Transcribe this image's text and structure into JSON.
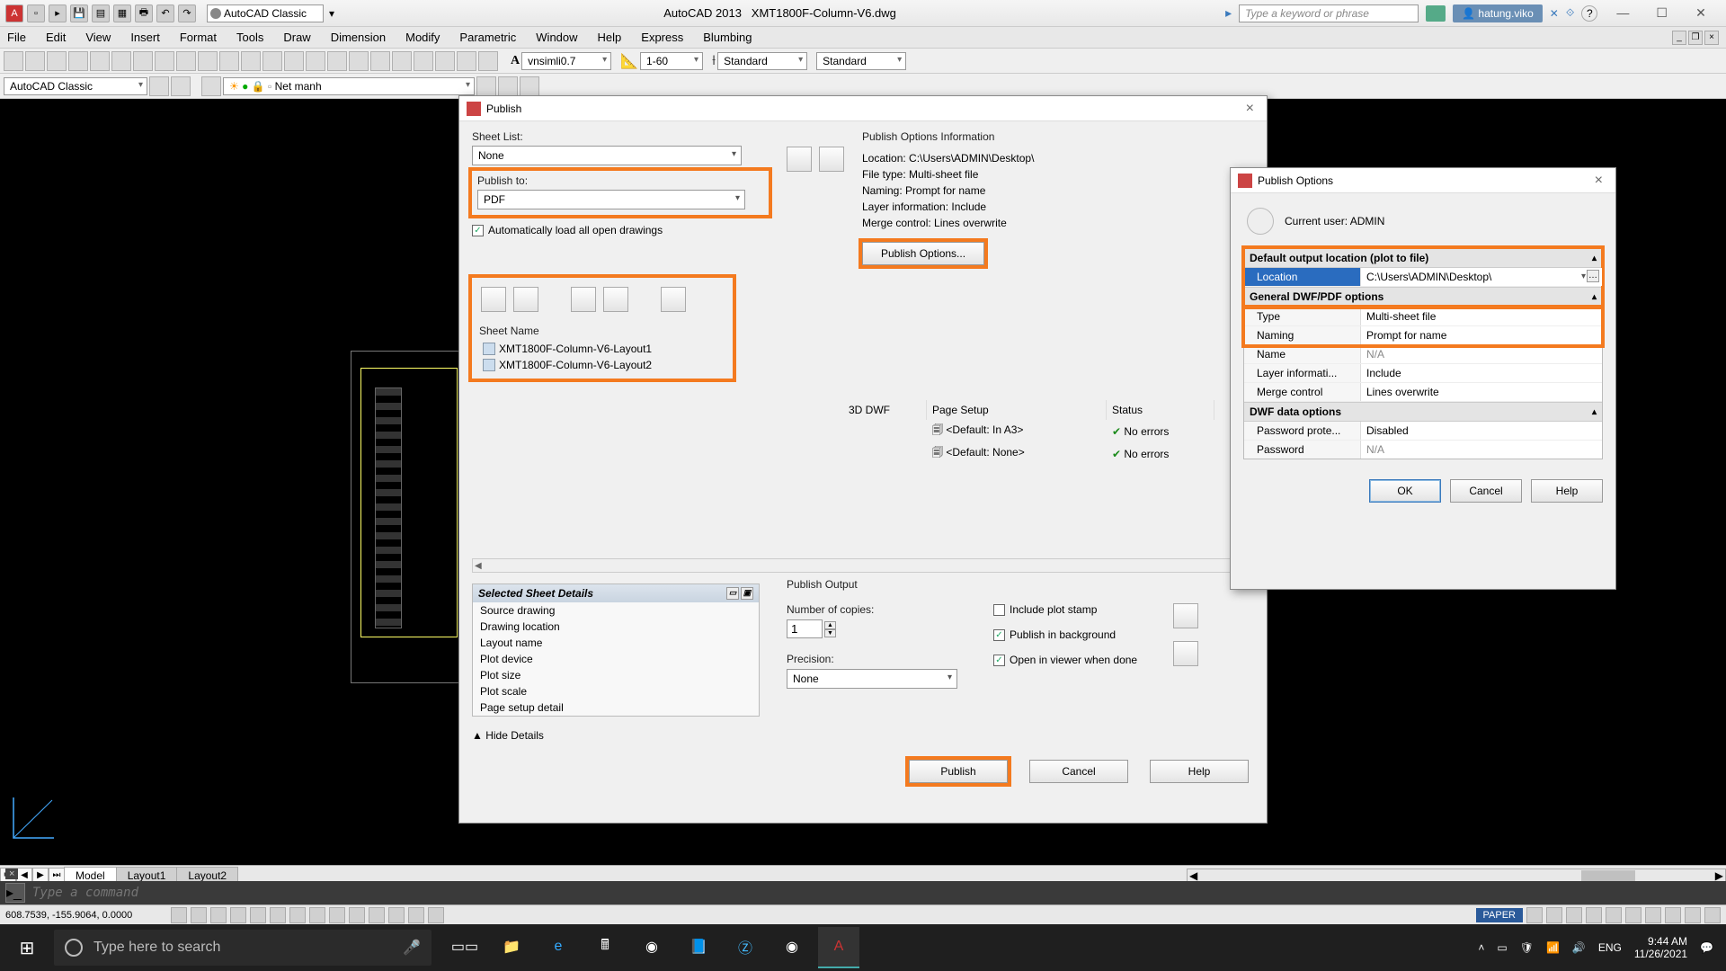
{
  "title_bar": {
    "workspace": "AutoCAD Classic",
    "app": "AutoCAD 2013",
    "file": "XMT1800F-Column-V6.dwg",
    "search_placeholder": "Type a keyword or phrase",
    "user": "hatung.viko"
  },
  "menu": [
    "File",
    "Edit",
    "View",
    "Insert",
    "Format",
    "Tools",
    "Draw",
    "Dimension",
    "Modify",
    "Parametric",
    "Window",
    "Help",
    "Express",
    "Blumbing"
  ],
  "toolbar2": {
    "workspace": "AutoCAD Classic",
    "layer": "Net manh",
    "font": "vnsimli0.7",
    "scale": "1-60",
    "dimstyle1": "Standard",
    "dimstyle2": "Standard"
  },
  "layout_tabs": {
    "tabs": [
      "Model",
      "Layout1",
      "Layout2"
    ],
    "active": "Model"
  },
  "cmdline": {
    "placeholder": "Type a command"
  },
  "status": {
    "coords": "608.7539, -155.9064, 0.0000",
    "paper": "PAPER",
    "lang": "ENG"
  },
  "taskbar": {
    "search": "Type here to search",
    "time": "9:44 AM",
    "date": "11/26/2021"
  },
  "publish": {
    "title": "Publish",
    "sheet_list_label": "Sheet List:",
    "sheet_list_value": "None",
    "publish_to_label": "Publish to:",
    "publish_to_value": "PDF",
    "auto_load": "Automatically load all open drawings",
    "info_title": "Publish Options Information",
    "info": {
      "location_label": "Location:",
      "location": "C:\\Users\\ADMIN\\Desktop\\",
      "filetype_label": "File type:",
      "filetype": "Multi-sheet file",
      "naming_label": "Naming:",
      "naming": "Prompt for name",
      "layer_label": "Layer information:",
      "layer": "Include",
      "merge_label": "Merge control:",
      "merge": "Lines overwrite"
    },
    "publish_options_btn": "Publish Options...",
    "columns": {
      "sheet": "Sheet Name",
      "dwf": "3D DWF",
      "page": "Page Setup",
      "status": "Status"
    },
    "sheets": [
      {
        "name": "XMT1800F-Column-V6-Layout1",
        "page": "<Default: In A3>",
        "status": "No errors"
      },
      {
        "name": "XMT1800F-Column-V6-Layout2",
        "page": "<Default: None>",
        "status": "No errors"
      }
    ],
    "details_title": "Selected Sheet Details",
    "details": [
      "Source drawing",
      "Drawing location",
      "Layout name",
      "Plot device",
      "Plot size",
      "Plot scale",
      "Page setup detail"
    ],
    "hide_details": "Hide Details",
    "output_title": "Publish Output",
    "copies_label": "Number of copies:",
    "copies": "1",
    "precision_label": "Precision:",
    "precision": "None",
    "stamp": "Include plot stamp",
    "background": "Publish in background",
    "open_viewer": "Open in viewer when done",
    "btn_publish": "Publish",
    "btn_cancel": "Cancel",
    "btn_help": "Help"
  },
  "pubopt": {
    "title": "Publish Options",
    "current_user_label": "Current user:",
    "current_user": "ADMIN",
    "sec1": "Default output location (plot to file)",
    "sec2": "General DWF/PDF options",
    "sec3": "DWF data options",
    "rows": {
      "location": {
        "name": "Location",
        "value": "C:\\Users\\ADMIN\\Desktop\\"
      },
      "type": {
        "name": "Type",
        "value": "Multi-sheet file"
      },
      "naming": {
        "name": "Naming",
        "value": "Prompt for name"
      },
      "name": {
        "name": "Name",
        "value": "N/A"
      },
      "layer": {
        "name": "Layer informati...",
        "value": "Include"
      },
      "merge": {
        "name": "Merge control",
        "value": "Lines overwrite"
      },
      "pwdprot": {
        "name": "Password prote...",
        "value": "Disabled"
      },
      "pwd": {
        "name": "Password",
        "value": "N/A"
      }
    },
    "ok": "OK",
    "cancel": "Cancel",
    "help": "Help"
  }
}
